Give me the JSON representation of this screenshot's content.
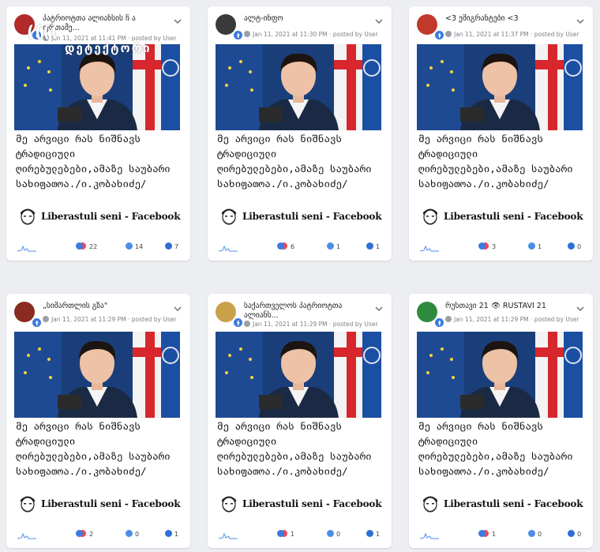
{
  "overlay": {
    "line1": "((((",
    "line2": "დეტექტორი"
  },
  "post": {
    "text": "მე არვიცი რას ნიშნავს ტრადიციული ღირებულებები,ამაზე საუბარი სახიფათოა./ი.კობახიძე/",
    "logo_text": "Liberastuli seni - Facebook"
  },
  "cards": [
    {
      "page": "პატრიოტთა ალიანსის ჩ ა ფრთამე...",
      "date": "Jan 11, 2021 at 11:41 PM",
      "posted_by": "posted by User",
      "reactions": "22",
      "comments": "14",
      "shares": "7",
      "avatar_color": "#b22a2a"
    },
    {
      "page": "ალტ-ინფო",
      "date": "Jan 11, 2021 at 11:30 PM",
      "posted_by": "posted by User",
      "reactions": "6",
      "comments": "1",
      "shares": "1",
      "avatar_color": "#3a3a3a"
    },
    {
      "page": "<3 ემიგრანტები <3",
      "date": "Jan 11, 2021 at 11:37 PM",
      "posted_by": "posted by User",
      "reactions": "3",
      "comments": "1",
      "shares": "0",
      "avatar_color": "#c0392b"
    },
    {
      "page": "„სიმართლის გზა\"",
      "date": "Jan 11, 2021 at 11:29 PM",
      "posted_by": "posted by User",
      "reactions": "2",
      "comments": "0",
      "shares": "1",
      "avatar_color": "#8a2b1f"
    },
    {
      "page": "საქართველოს პატრიოტთა ალიანს...",
      "date": "Jan 11, 2021 at 11:29 PM",
      "posted_by": "posted by User",
      "reactions": "1",
      "comments": "0",
      "shares": "1",
      "avatar_color": "#c8a24a"
    },
    {
      "page": "რუსთავი 21 👁 RUSTAVI 21",
      "date": "Jan 11, 2021 at 11:29 PM",
      "posted_by": "posted by User",
      "reactions": "1",
      "comments": "0",
      "shares": "0",
      "avatar_color": "#2e8b3d"
    }
  ]
}
